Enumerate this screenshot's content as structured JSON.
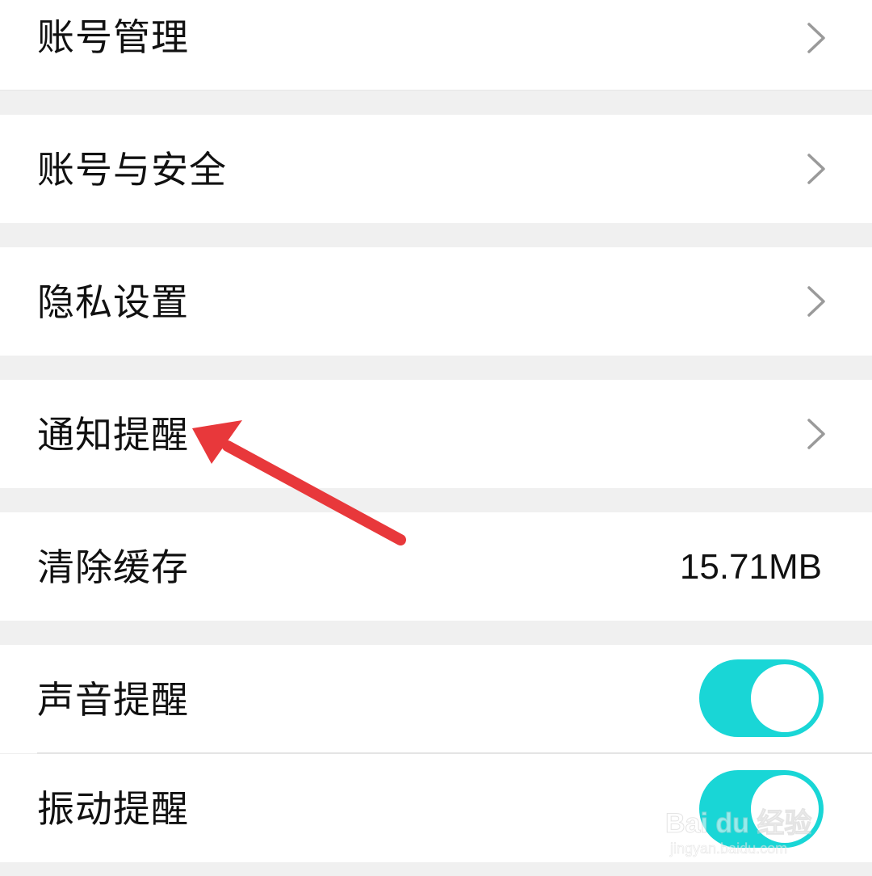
{
  "settings": {
    "items": [
      {
        "label": "账号管理"
      },
      {
        "label": "账号与安全"
      },
      {
        "label": "隐私设置"
      },
      {
        "label": "通知提醒"
      },
      {
        "label": "清除缓存",
        "value": "15.71MB"
      },
      {
        "label": "声音提醒",
        "toggle_on": true
      },
      {
        "label": "振动提醒",
        "toggle_on": true
      }
    ]
  },
  "colors": {
    "toggle_on": "#19d6d6",
    "annotation_arrow": "#e8383b",
    "page_background": "#f0f0f0"
  },
  "icons": {
    "chevron": "chevron-right-icon"
  },
  "watermark": {
    "brand": "Bai du 经验",
    "url": "jingyan.baidu.com"
  }
}
